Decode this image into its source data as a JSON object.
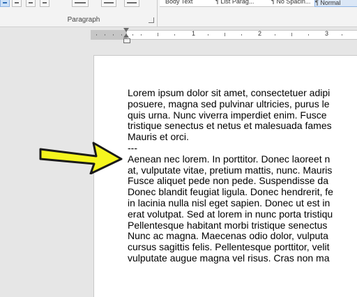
{
  "ribbon": {
    "paragraph_group_label": "Paragraph",
    "styles": [
      "Body Text",
      "¶ List Parag...",
      "¶ No Spacin...",
      "¶ Normal"
    ]
  },
  "ruler": {
    "numbers": [
      "1",
      "2",
      "3"
    ]
  },
  "document": {
    "lines": [
      "Lorem ipsum dolor sit amet, consectetuer adipi",
      "posuere, magna sed pulvinar ultricies, purus le",
      "quis urna. Nunc viverra imperdiet enim. Fusce",
      "tristique senectus et netus et malesuada fames",
      "Mauris et orci.",
      "---",
      "Aenean nec lorem. In porttitor. Donec laoreet n",
      "at, vulputate vitae, pretium mattis, nunc. Mauris",
      "Fusce aliquet pede non pede. Suspendisse da",
      "Donec blandit feugiat ligula. Donec hendrerit, fe",
      "in lacinia nulla nisl eget sapien. Donec ut est in",
      "erat volutpat. Sed at lorem in nunc porta tristiqu",
      "Pellentesque habitant morbi tristique senectus",
      "Nunc ac magna. Maecenas odio dolor, vulputa",
      "cursus sagittis felis. Pellentesque porttitor, velit",
      "vulputate augue magna vel risus. Cras non ma"
    ]
  },
  "annotation": {
    "arrow_color": "#f5f51e",
    "arrow_outline": "#1a1a1a"
  }
}
